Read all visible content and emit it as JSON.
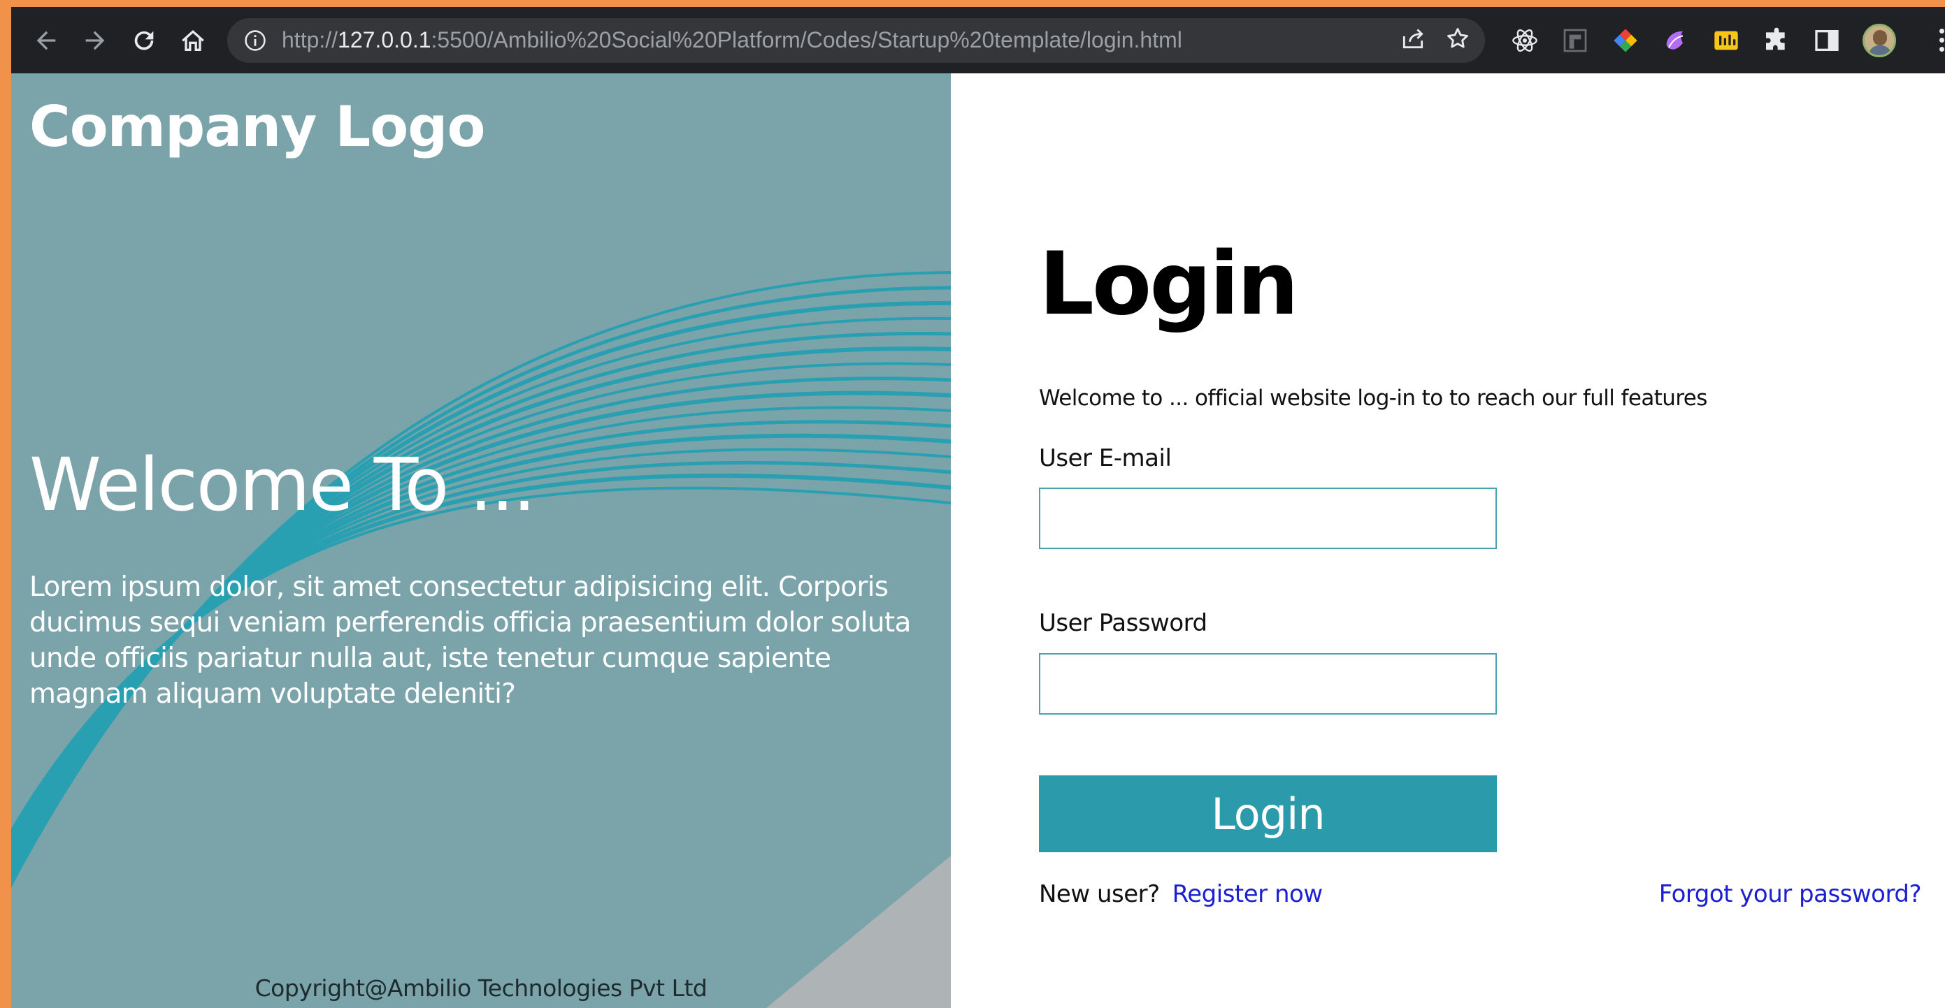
{
  "browser": {
    "url_prefix": "http://",
    "url_host": "127.0.0.1",
    "url_rest": ":5500/Ambilio%20Social%20Platform/Codes/Startup%20template/login.html",
    "nav_icons": [
      "back-arrow-icon",
      "forward-arrow-icon",
      "reload-icon",
      "home-icon"
    ],
    "omnibox_icons": [
      "site-info-icon",
      "share-icon",
      "bookmark-star-icon"
    ],
    "extension_icons": [
      "react-devtools-icon",
      "extension-tile-icon",
      "color-picker-extension-icon",
      "extension-purple-icon",
      "extension-yellow-icon",
      "extensions-puzzle-icon",
      "side-panel-icon",
      "profile-avatar-icon",
      "more-menu-icon"
    ]
  },
  "hero": {
    "logo": "Company Logo",
    "heading": "Welcome To ...",
    "body": "Lorem ipsum dolor, sit amet consectetur adipisicing elit. Corporis ducimus sequi veniam perferendis officia praesentium dolor soluta unde officiis pariatur nulla aut, iste tenetur cumque sapiente magnam aliquam voluptate deleniti?",
    "copyright": "Copyright@Ambilio Technologies Pvt Ltd",
    "background_color": "#7aa3aa",
    "wave_color": "#1ba0b4"
  },
  "login": {
    "title": "Login",
    "subtitle": "Welcome to ... official website log-in to to reach our full features",
    "email_label": "User E-mail",
    "email_value": "",
    "password_label": "User Password",
    "password_value": "",
    "button_label": "Login",
    "new_user_text": "New user?",
    "register_link": "Register now",
    "forgot_link": "Forgot your password?",
    "button_color": "#2b9aab",
    "link_color": "#1c1fcf"
  }
}
